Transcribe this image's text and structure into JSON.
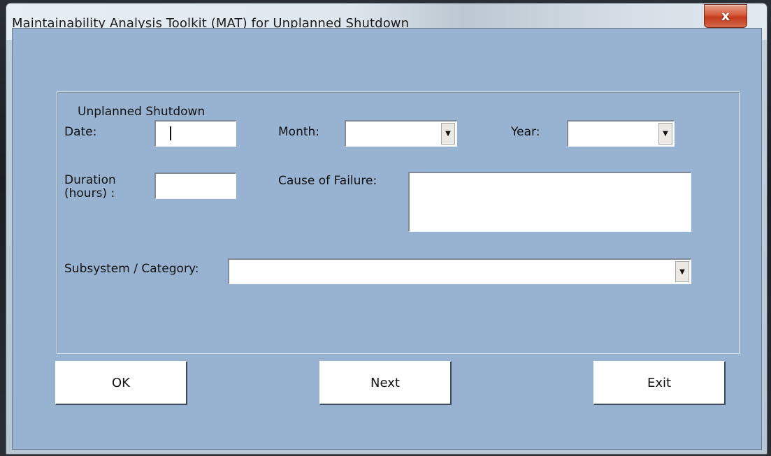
{
  "window": {
    "title": "Maintainability Analysis Toolkit (MAT) for Unplanned Shutdown",
    "close_label": "x"
  },
  "frame": {
    "legend": "Unplanned Shutdown"
  },
  "fields": {
    "date": {
      "label": "Date:",
      "value": ""
    },
    "month": {
      "label": "Month:",
      "value": ""
    },
    "year": {
      "label": "Year:",
      "value": ""
    },
    "duration": {
      "label_line1": "Duration",
      "label_line2": "(hours) :",
      "value": ""
    },
    "cause": {
      "label": "Cause of Failure:",
      "value": ""
    },
    "subsystem": {
      "label": "Subsystem / Category:",
      "value": ""
    }
  },
  "buttons": {
    "ok": "OK",
    "next": "Next",
    "exit": "Exit"
  },
  "icons": {
    "dropdown": "chevron-down-icon",
    "close": "close-icon"
  }
}
